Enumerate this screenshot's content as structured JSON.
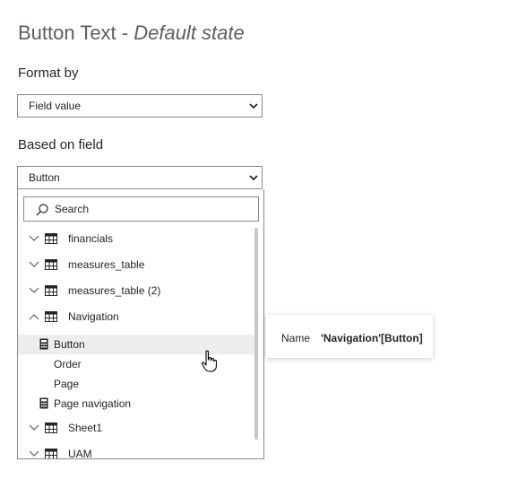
{
  "title": {
    "main": "Button Text - ",
    "state": "Default state"
  },
  "format_by": {
    "label": "Format by",
    "value": "Field value"
  },
  "based_on_field": {
    "label": "Based on field",
    "value": "Button"
  },
  "search": {
    "placeholder": "Search"
  },
  "tree": {
    "tables": [
      {
        "label": "financials",
        "expanded": false
      },
      {
        "label": "measures_table",
        "expanded": false
      },
      {
        "label": "measures_table (2)",
        "expanded": false
      },
      {
        "label": "Navigation",
        "expanded": true
      },
      {
        "label": "Sheet1",
        "expanded": false
      },
      {
        "label": "UAM",
        "expanded": false
      }
    ],
    "navigation_fields": [
      {
        "label": "Button",
        "selected": true,
        "type": "measure"
      },
      {
        "label": "Order",
        "selected": false,
        "type": "column"
      },
      {
        "label": "Page",
        "selected": false,
        "type": "column"
      },
      {
        "label": "Page navigation",
        "selected": false,
        "type": "measure"
      }
    ]
  },
  "tooltip": {
    "name_label": "Name",
    "name_value": "'Navigation'[Button]"
  },
  "colors": {
    "border": "#8a8886",
    "selected_row": "#ededed",
    "text": "#252423"
  },
  "icons": [
    "chevron-down-icon",
    "search-icon",
    "table-icon",
    "calculator-icon",
    "expand-chevron-icon",
    "collapse-chevron-icon",
    "hand-cursor-icon"
  ]
}
